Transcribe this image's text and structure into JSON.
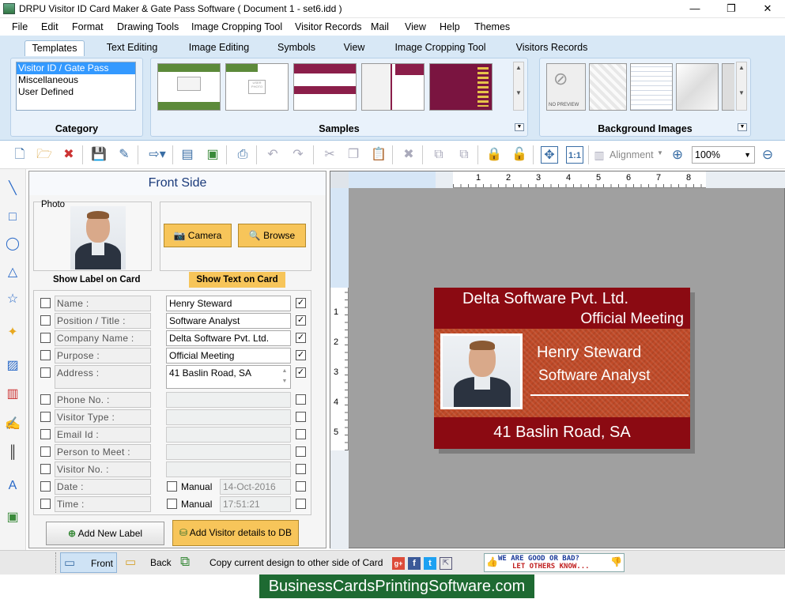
{
  "window": {
    "title": "DRPU Visitor ID Card Maker & Gate Pass Software ( Document 1 - set6.idd )",
    "min": "—",
    "max": "❐",
    "close": "✕"
  },
  "menu": [
    "File",
    "Edit",
    "Format",
    "Drawing Tools",
    "Image Cropping Tool",
    "Visitor Records",
    "Mail",
    "View",
    "Help",
    "Themes"
  ],
  "ribbon_tabs": [
    "Templates",
    "Text Editing",
    "Image Editing",
    "Symbols",
    "View",
    "Image Cropping Tool",
    "Visitors Records"
  ],
  "ribbon": {
    "category_label": "Category",
    "samples_label": "Samples",
    "background_label": "Background Images",
    "categories": [
      "Visitor ID / Gate Pass",
      "Miscellaneous",
      "User Defined"
    ],
    "thumb_photo_text": "USER PHOTO",
    "no_preview": "NO PREVIEW"
  },
  "toolbar": {
    "alignment": "Alignment",
    "zoom": "100%"
  },
  "form": {
    "header": "Front Side",
    "photo_label": "Photo",
    "camera": "Camera",
    "browse": "Browse",
    "show_label": "Show Label on Card",
    "show_text": "Show Text on Card",
    "fields": [
      {
        "label": "Name :",
        "value": "Henry Steward",
        "checked": true
      },
      {
        "label": "Position / Title :",
        "value": "Software Analyst",
        "checked": true
      },
      {
        "label": "Company Name :",
        "value": "Delta Software Pvt. Ltd.",
        "checked": true
      },
      {
        "label": "Purpose :",
        "value": "Official Meeting",
        "checked": true
      },
      {
        "label": "Address :",
        "value": "41 Baslin Road, SA",
        "checked": true
      },
      {
        "label": "Phone No. :",
        "value": "",
        "checked": false
      },
      {
        "label": "Visitor Type :",
        "value": "",
        "checked": false
      },
      {
        "label": "Email Id :",
        "value": "",
        "checked": false
      },
      {
        "label": "Person to Meet :",
        "value": "",
        "checked": false
      },
      {
        "label": "Visitor No. :",
        "value": "",
        "checked": false
      },
      {
        "label": "Date :",
        "value": "14-Oct-2016",
        "checked": false
      },
      {
        "label": "Time :",
        "value": "17:51:21",
        "checked": false
      }
    ],
    "manual": "Manual",
    "add_label": "Add New Label",
    "add_visitor": "Add Visitor details to DB"
  },
  "ruler": {
    "h": [
      "1",
      "2",
      "3",
      "4",
      "5",
      "6",
      "7",
      "8"
    ],
    "v": [
      "1",
      "2",
      "3",
      "4",
      "5"
    ]
  },
  "card": {
    "company": "Delta Software Pvt. Ltd.",
    "purpose": "Official Meeting",
    "name": "Henry Steward",
    "title": "Software Analyst",
    "address": "41 Baslin Road, SA",
    "colors": {
      "band": "#8b0a12",
      "body": "#c04a28"
    }
  },
  "status": {
    "front": "Front",
    "back": "Back",
    "copy": "Copy current design to other side of Card",
    "feedback_1": "WE ARE GOOD OR BAD?",
    "feedback_2": "LET OTHERS KNOW..."
  },
  "footer": "BusinessCardsPrintingSoftware.com"
}
